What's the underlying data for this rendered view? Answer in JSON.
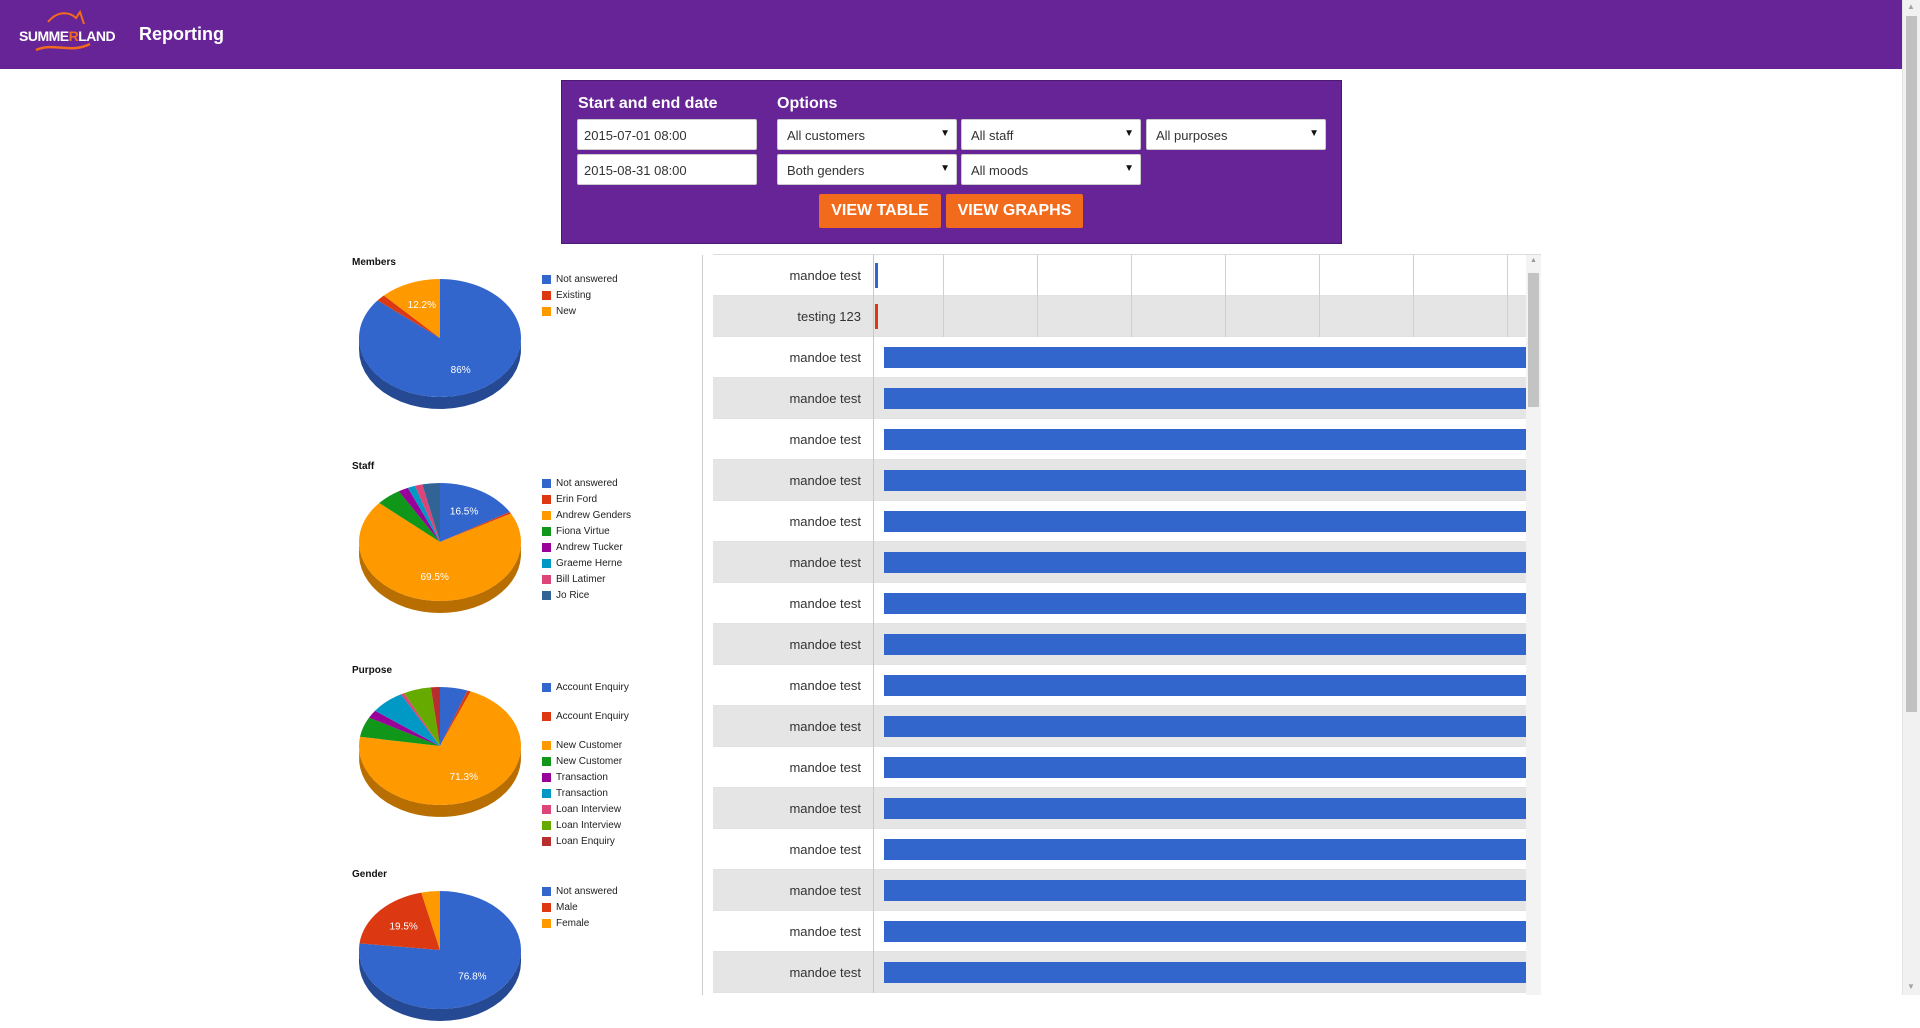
{
  "header": {
    "logo_text_left": "SUMME",
    "logo_text_r": "R",
    "logo_text_right": "LAND",
    "title": "Reporting"
  },
  "filters": {
    "date_heading": "Start and end date",
    "options_heading": "Options",
    "start_date": "2015-07-01 08:00",
    "end_date": "2015-08-31 08:00",
    "customers": "All customers",
    "staff": "All staff",
    "purposes": "All purposes",
    "genders": "Both genders",
    "moods": "All moods",
    "view_table_label": "VIEW TABLE",
    "view_graphs_label": "VIEW GRAPHS"
  },
  "chart_data": [
    {
      "type": "pie",
      "title": "Members",
      "labels": [
        "Not answered",
        "Existing",
        "New"
      ],
      "values": [
        86.0,
        1.8,
        12.2
      ],
      "colors": [
        "#3366cc",
        "#dc3912",
        "#ff9900"
      ],
      "slice_labels": [
        "86%",
        "",
        "12.2%"
      ]
    },
    {
      "type": "pie",
      "title": "Staff",
      "labels": [
        "Not answered",
        "Erin Ford",
        "Andrew Genders",
        "Fiona Virtue",
        "Andrew Tucker",
        "Graeme Herne",
        "Bill Latimer",
        "Jo Rice"
      ],
      "values": [
        16.5,
        0.5,
        69.5,
        5.0,
        2.0,
        1.5,
        1.5,
        3.5
      ],
      "colors": [
        "#3366cc",
        "#dc3912",
        "#ff9900",
        "#109618",
        "#990099",
        "#0099c6",
        "#dd4477",
        "#316395"
      ],
      "slice_labels": [
        "16.5%",
        "",
        "69.5%",
        "",
        "",
        "",
        "",
        ""
      ]
    },
    {
      "type": "pie",
      "title": "Purpose",
      "labels": [
        "Account Enquiry",
        "Account Enquiry",
        "New Customer",
        "New Customer",
        "Transaction",
        "Transaction",
        "Loan Interview",
        "Loan Interview",
        "Loan Enquiry"
      ],
      "values": [
        5.5,
        0.7,
        71.3,
        5.5,
        2.2,
        6.8,
        0.7,
        5.5,
        1.8
      ],
      "colors": [
        "#3366cc",
        "#dc3912",
        "#ff9900",
        "#109618",
        "#990099",
        "#0099c6",
        "#dd4477",
        "#66aa00",
        "#b82e2e"
      ],
      "slice_labels": [
        "",
        "",
        "71.3%",
        "",
        "",
        "",
        "",
        "",
        ""
      ]
    },
    {
      "type": "pie",
      "title": "Gender",
      "labels": [
        "Not answered",
        "Male",
        "Female"
      ],
      "values": [
        76.8,
        19.5,
        3.7
      ],
      "colors": [
        "#3366cc",
        "#dc3912",
        "#ff9900"
      ],
      "slice_labels": [
        "76.8%",
        "19.5%",
        ""
      ]
    },
    {
      "type": "bar",
      "orientation": "horizontal",
      "categories": [
        "mandoe test",
        "testing 123",
        "mandoe test",
        "mandoe test",
        "mandoe test",
        "mandoe test",
        "mandoe test",
        "mandoe test",
        "mandoe test",
        "mandoe test",
        "mandoe test",
        "mandoe test",
        "mandoe test",
        "mandoe test",
        "mandoe test",
        "mandoe test",
        "mandoe test",
        "mandoe test"
      ],
      "values": [
        0.4,
        0.4,
        100,
        100,
        100,
        100,
        100,
        100,
        100,
        100,
        100,
        100,
        100,
        100,
        100,
        100,
        100,
        100
      ],
      "bar_colors": [
        "#3366cc",
        "#dc3912",
        "#3366cc",
        "#3366cc",
        "#3366cc",
        "#3366cc",
        "#3366cc",
        "#3366cc",
        "#3366cc",
        "#3366cc",
        "#3366cc",
        "#3366cc",
        "#3366cc",
        "#3366cc",
        "#3366cc",
        "#3366cc",
        "#3366cc",
        "#3366cc"
      ],
      "grid": true
    }
  ]
}
